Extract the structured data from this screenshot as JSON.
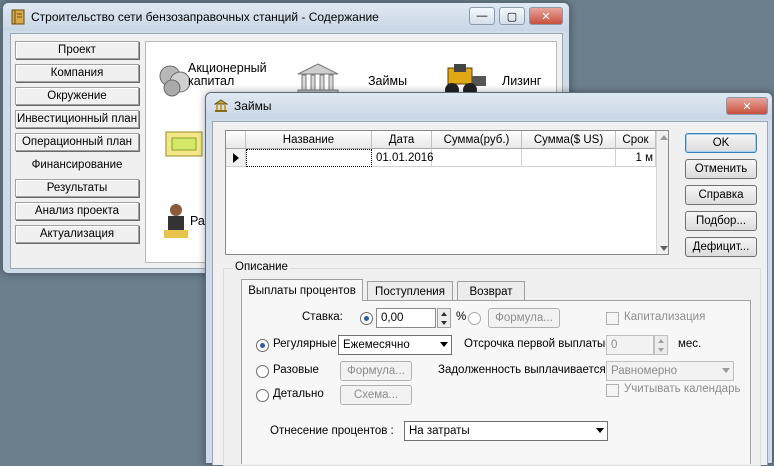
{
  "main_window": {
    "title": "Строительство сети бензозаправочных станций - Содержание",
    "nav": [
      "Проект",
      "Компания",
      "Окружение",
      "Инвестиционный план",
      "Операционный план",
      "Финансирование",
      "Результаты",
      "Анализ проекта",
      "Актуализация"
    ],
    "active_nav": "Финансирование",
    "icons": {
      "stock": "Акционерный капитал",
      "loans": "Займы",
      "leasing": "Лизинг",
      "distribution": "Расп"
    }
  },
  "dialog": {
    "title": "Займы",
    "grid": {
      "headers": [
        "Название",
        "Дата",
        "Сумма(руб.)",
        "Сумма($ US)",
        "Срок"
      ],
      "row": {
        "name": "",
        "date": "01.01.2016",
        "sum_rub": "",
        "sum_usd": "",
        "term": "1 м"
      }
    },
    "buttons": {
      "ok": "OK",
      "cancel": "Отменить",
      "help": "Справка",
      "pick": "Подбор...",
      "deficit": "Дефицит..."
    },
    "description_label": "Описание",
    "tabs": [
      "Выплаты процентов",
      "Поступления",
      "Возврат"
    ],
    "form": {
      "rate_label": "Ставка:",
      "rate_value": "0,00",
      "percent": "%",
      "formula_btn": "Формула...",
      "capitalization": "Капитализация",
      "regular": "Регулярные",
      "period_value": "Ежемесячно",
      "first_delay_label": "Отсрочка первой выплаты",
      "first_delay_value": "0",
      "months": "мес.",
      "one_time": "Разовые",
      "formula_btn2": "Формула...",
      "debt_label": "Задолженность выплачивается",
      "debt_value": "Равномерно",
      "detailed": "Детально",
      "scheme_btn": "Схема...",
      "calendar": "Учитывать календарь",
      "attribution_label": "Отнесение процентов :",
      "attribution_value": "На затраты"
    }
  }
}
